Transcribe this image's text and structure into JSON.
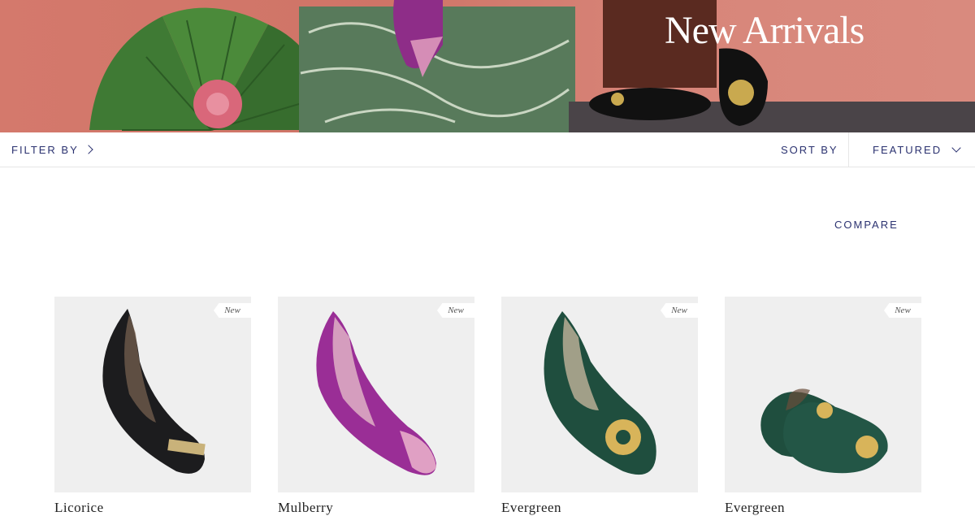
{
  "hero": {
    "title": "New Arrivals"
  },
  "toolbar": {
    "filter_label": "FILTER BY",
    "sort_label": "SORT BY",
    "sort_value": "FEATURED"
  },
  "compare_label": "COMPARE",
  "products": [
    {
      "name": "Licorice",
      "badge": "New",
      "color": "#1c1c1e",
      "accent": "#c9b27a"
    },
    {
      "name": "Mulberry",
      "badge": "New",
      "color": "#9a2e96",
      "accent": "#e0a0c4"
    },
    {
      "name": "Evergreen",
      "badge": "New",
      "color": "#1f4e3e",
      "accent": "#d8b45a"
    },
    {
      "name": "Evergreen",
      "badge": "New",
      "color": "#1f4e3e",
      "accent": "#d8b45a"
    }
  ]
}
